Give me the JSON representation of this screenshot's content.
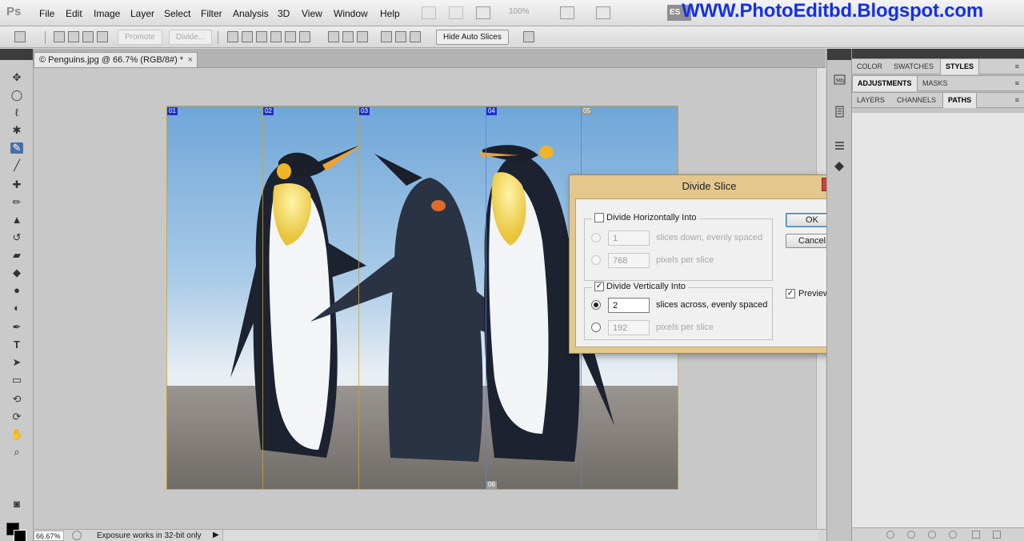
{
  "app": {
    "logo": "Ps"
  },
  "menu": [
    "File",
    "Edit",
    "Image",
    "Layer",
    "Select",
    "Filter",
    "Analysis",
    "3D",
    "View",
    "Window",
    "Help"
  ],
  "app_bar": {
    "zoom": "100%",
    "workspace": "ES"
  },
  "watermark": "WWW.PhotoEditbd.Blogspot.com",
  "options_bar": {
    "promote": "Promote",
    "divide": "Divide...",
    "hide_auto_slices": "Hide Auto Slices"
  },
  "document": {
    "tab_title": "© Penguins.jpg @ 66.7% (RGB/8#) *",
    "close": "×"
  },
  "slices": [
    {
      "label": "01",
      "type": "user"
    },
    {
      "label": "02",
      "type": "user"
    },
    {
      "label": "03",
      "type": "user"
    },
    {
      "label": "04",
      "type": "user"
    },
    {
      "label": "05",
      "type": "auto"
    },
    {
      "label": "06",
      "type": "auto"
    }
  ],
  "dialog": {
    "title": "Divide Slice",
    "close": "×",
    "horizontal": {
      "label": "Divide Horizontally Into",
      "checked": false,
      "slices_value": "1",
      "slices_label": "slices down, evenly spaced",
      "pixels_value": "768",
      "pixels_label": "pixels per slice"
    },
    "vertical": {
      "label": "Divide Vertically Into",
      "checked": true,
      "slices_value": "2",
      "slices_label": "slices across, evenly spaced",
      "pixels_value": "192",
      "pixels_label": "pixels per slice"
    },
    "ok": "OK",
    "cancel": "Cancel",
    "preview": "Preview",
    "check_mark": "✓"
  },
  "panels": {
    "group1": [
      "COLOR",
      "SWATCHES",
      "STYLES"
    ],
    "group1_active": "STYLES",
    "group2": [
      "ADJUSTMENTS",
      "MASKS"
    ],
    "group2_active": "ADJUSTMENTS",
    "group3": [
      "LAYERS",
      "CHANNELS",
      "PATHS"
    ],
    "group3_active": "PATHS",
    "menu_glyph": "≡"
  },
  "status": {
    "zoom": "66.67%",
    "text": "Exposure works in 32-bit only"
  },
  "colors": {
    "accent_slice": "#1d2fd0",
    "dialog_frame": "#e3c78d",
    "watermark": "#1430e8"
  }
}
